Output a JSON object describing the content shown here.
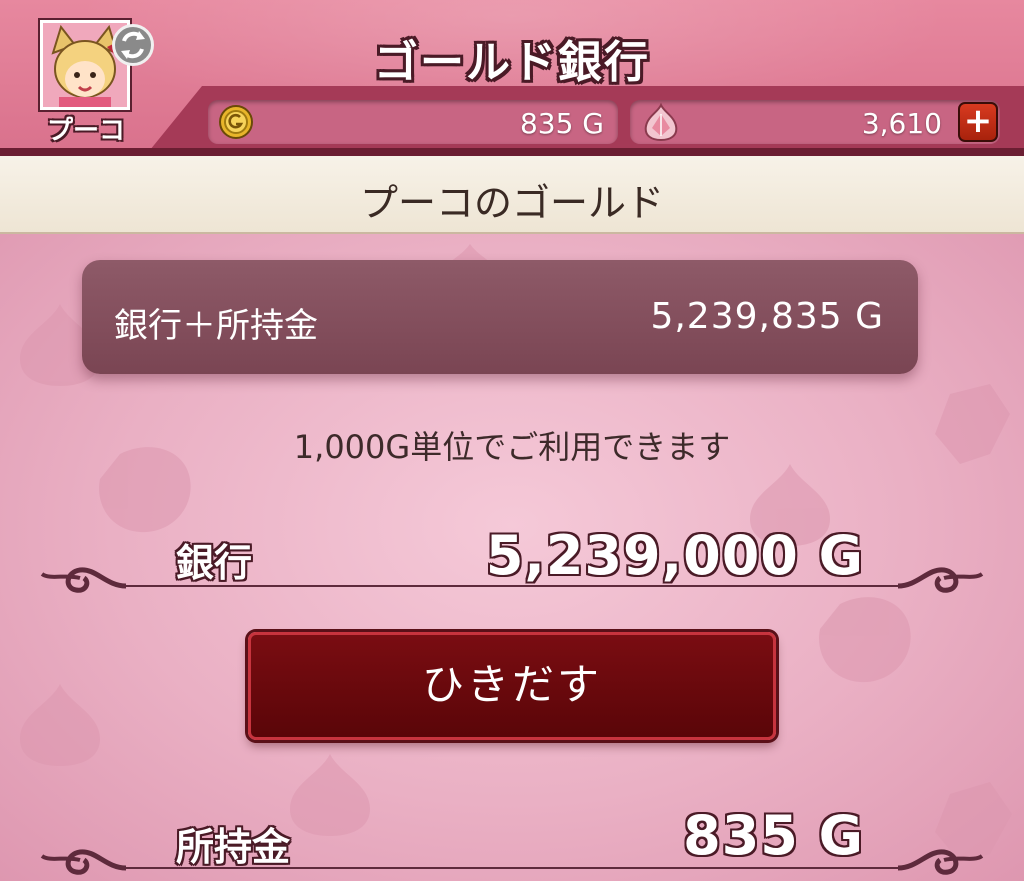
{
  "header": {
    "title": "ゴールド銀行",
    "player_name": "プーコ",
    "gold_amount": "835 G",
    "gem_amount": "3,610",
    "plus_label": "+"
  },
  "subheader": {
    "title": "プーコのゴールド"
  },
  "summary": {
    "label": "銀行＋所持金",
    "value": "5,239,835 G"
  },
  "info": {
    "text": "1,000G単位でご利用できます"
  },
  "bank": {
    "label": "銀行",
    "value": "5,239,000 G"
  },
  "actions": {
    "withdraw_label": "ひきだす"
  },
  "held": {
    "label": "所持金",
    "value": "835 G"
  },
  "colors": {
    "header_pink": "#d9718c",
    "bar_shelf": "#a53a57",
    "button_red": "#6a0a0e",
    "background_pink": "#eab0c4"
  },
  "icons": {
    "avatar": "character-avatar",
    "swap": "swap-character-icon",
    "coin": "gold-coin-icon",
    "gem": "gem-icon",
    "plus": "plus-icon"
  }
}
